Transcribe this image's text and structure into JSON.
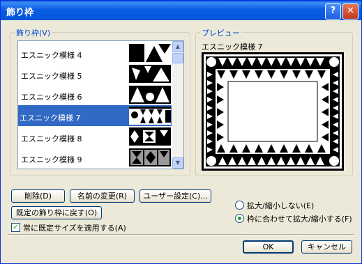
{
  "window": {
    "title": "飾り枠"
  },
  "titlebar": {
    "help_glyph": "?",
    "close_glyph": "✕"
  },
  "frames": {
    "label": "飾り枠(V)",
    "items": [
      {
        "label": "エスニック模様 4"
      },
      {
        "label": "エスニック模様 5"
      },
      {
        "label": "エスニック模様 6"
      },
      {
        "label": "エスニック模様 7",
        "selected": true
      },
      {
        "label": "エスニック模様 8"
      },
      {
        "label": "エスニック模様 9"
      }
    ],
    "scroll_up_glyph": "▲",
    "scroll_down_glyph": "▼"
  },
  "preview": {
    "label": "プレビュー",
    "name": "エスニック模様 7"
  },
  "buttons": {
    "delete": "削除(D)",
    "rename": "名前の変更(R)",
    "user_settings": "ユーザー設定(C)...",
    "revert": "既定の飾り枠に戻す(O)",
    "ok": "OK",
    "cancel": "キャンセル"
  },
  "options": {
    "apply_default_size": {
      "label": "常に既定サイズを適用する(A)",
      "checked": true
    },
    "no_scale": {
      "label": "拡大/縮小しない(E)",
      "selected": false
    },
    "fit_scale": {
      "label": "枠に合わせて拡大/縮小する(F)",
      "selected": true
    }
  },
  "colors": {
    "titlebar": "#0a5ee6",
    "selection": "#316ac5",
    "group_label": "#0046d5"
  }
}
